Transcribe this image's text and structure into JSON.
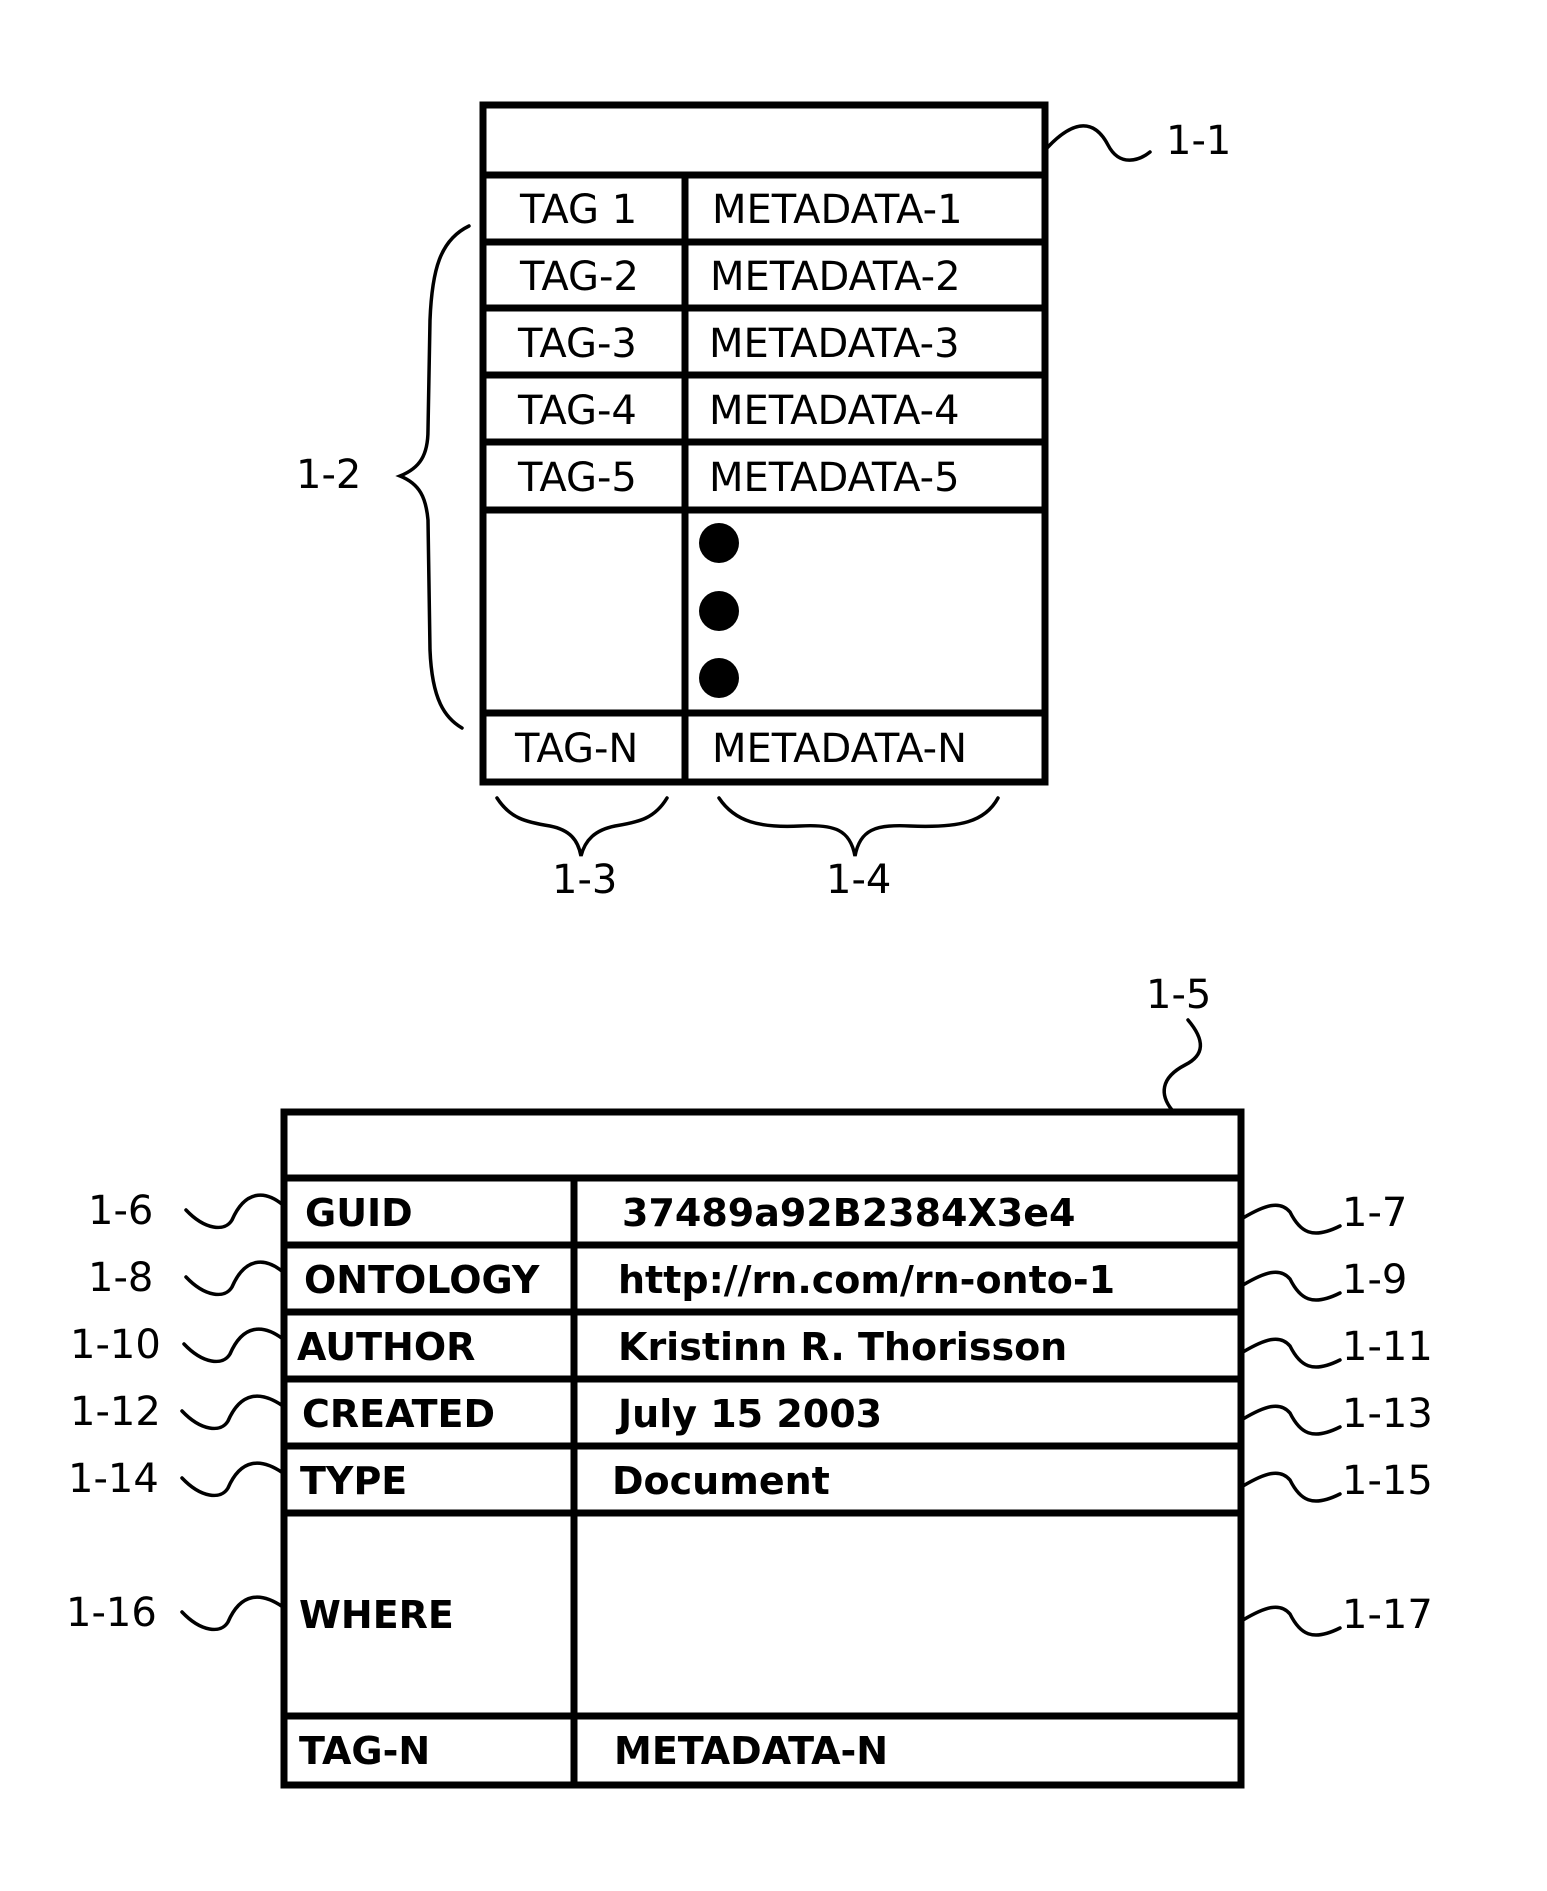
{
  "figure": {
    "top_table": {
      "ref_record": "1-1",
      "ref_rows": "1-2",
      "ref_tag_column": "1-3",
      "ref_metadata_column": "1-4",
      "rows": [
        {
          "tag": "TAG 1",
          "metadata": "METADATA-1"
        },
        {
          "tag": "TAG-2",
          "metadata": "METADATA-2"
        },
        {
          "tag": "TAG-3",
          "metadata": "METADATA-3"
        },
        {
          "tag": "TAG-4",
          "metadata": "METADATA-4"
        },
        {
          "tag": "TAG-5",
          "metadata": "METADATA-5"
        }
      ],
      "ellipsis_dots": 3,
      "last_row": {
        "tag": "TAG-N",
        "metadata": "METADATA-N"
      }
    },
    "bottom_table": {
      "ref_record": "1-5",
      "rows": [
        {
          "tag": "GUID",
          "value": "37489a92B2384X3e4",
          "ref_tag": "1-6",
          "ref_value": "1-7"
        },
        {
          "tag": "ONTOLOGY",
          "value": "http://rn.com/rn-onto-1",
          "ref_tag": "1-8",
          "ref_value": "1-9"
        },
        {
          "tag": "AUTHOR",
          "value": "Kristinn R. Thorisson",
          "ref_tag": "1-10",
          "ref_value": "1-11"
        },
        {
          "tag": "CREATED",
          "value": "July 15 2003",
          "ref_tag": "1-12",
          "ref_value": "1-13"
        },
        {
          "tag": "TYPE",
          "value": "Document",
          "ref_tag": "1-14",
          "ref_value": "1-15"
        },
        {
          "tag": "WHERE",
          "value": "",
          "ref_tag": "1-16",
          "ref_value": "1-17"
        }
      ],
      "last_row": {
        "tag": "TAG-N",
        "value": "METADATA-N"
      }
    }
  }
}
